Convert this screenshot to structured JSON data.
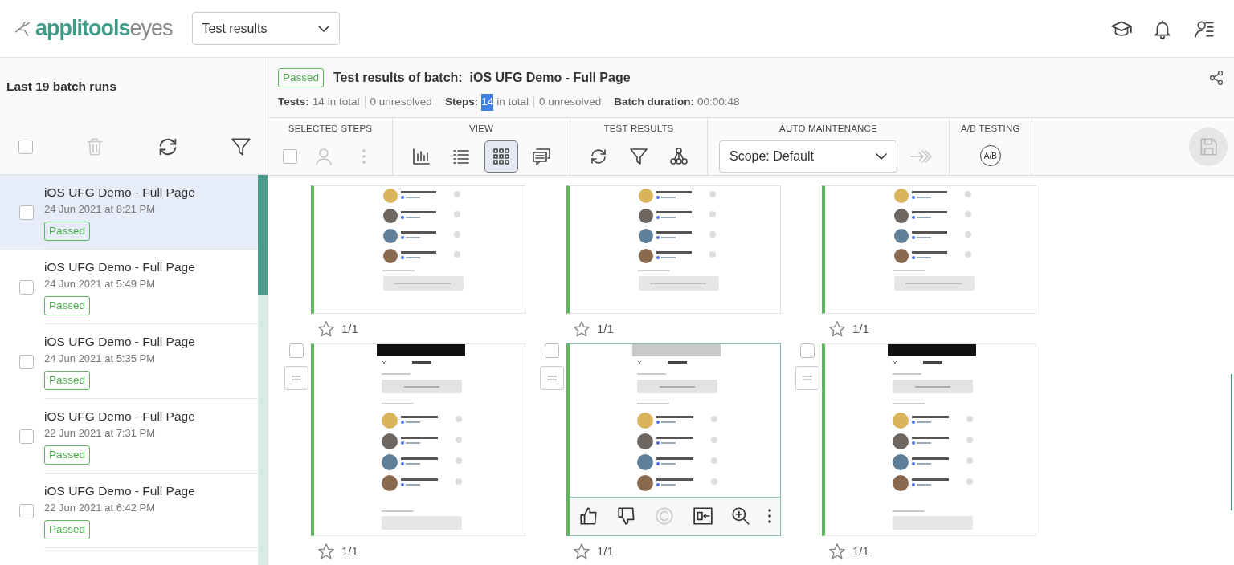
{
  "header": {
    "logo": {
      "brand": "applitools",
      "product": "eyes"
    },
    "view_select": {
      "value": "Test results"
    }
  },
  "sidebar": {
    "title": "Last 19 batch runs",
    "select_all": {
      "checked": false
    },
    "batches": [
      {
        "name": "iOS UFG Demo - Full Page",
        "date": "24 Jun 2021 at 8:21 PM",
        "status": "Passed",
        "selected": true,
        "checked": false
      },
      {
        "name": "iOS UFG Demo - Full Page",
        "date": "24 Jun 2021 at 5:49 PM",
        "status": "Passed",
        "selected": false,
        "checked": false
      },
      {
        "name": "iOS UFG Demo - Full Page",
        "date": "24 Jun 2021 at 5:35 PM",
        "status": "Passed",
        "selected": false,
        "checked": false
      },
      {
        "name": "iOS UFG Demo - Full Page",
        "date": "22 Jun 2021 at 7:31 PM",
        "status": "Passed",
        "selected": false,
        "checked": false
      },
      {
        "name": "iOS UFG Demo - Full Page",
        "date": "22 Jun 2021 at 6:42 PM",
        "status": "Passed",
        "selected": false,
        "checked": false
      }
    ]
  },
  "batch": {
    "status": "Passed",
    "title": "Test results of batch:",
    "name": "iOS UFG Demo - Full Page",
    "stats": [
      {
        "label": "Tests:",
        "count": "14",
        "count_selected": false,
        "suffix": "in total",
        "unresolved": "0 unresolved"
      },
      {
        "label": "Steps:",
        "count": "14",
        "count_selected": true,
        "suffix": "in total",
        "unresolved": "0 unresolved"
      }
    ],
    "duration": {
      "label": "Batch duration:",
      "value": "00:00:48"
    }
  },
  "toolbar": [
    {
      "title": "SELECTED STEPS",
      "tools": [
        {
          "kind": "checkbox",
          "checked": false
        },
        {
          "kind": "button",
          "disabled": true
        },
        {
          "kind": "button",
          "disabled": true
        }
      ]
    },
    {
      "title": "VIEW",
      "tools": [
        {
          "kind": "button",
          "selected": false
        },
        {
          "kind": "button",
          "selected": false
        },
        {
          "kind": "button",
          "selected": true
        },
        {
          "kind": "button",
          "selected": false
        }
      ]
    },
    {
      "title": "TEST RESULTS",
      "tools": [
        {
          "kind": "button"
        },
        {
          "kind": "button"
        },
        {
          "kind": "button"
        }
      ]
    },
    {
      "title": "AUTO MAINTENANCE",
      "tools": [
        {
          "kind": "select",
          "value": "Scope: Default"
        },
        {
          "kind": "button",
          "disabled": true
        }
      ]
    },
    {
      "title": "A/B TESTING",
      "tools": [
        {
          "kind": "text_button",
          "label": "A/B"
        }
      ]
    }
  ],
  "save": {
    "disabled": true
  },
  "steps": [
    {
      "kind": "list_bottom",
      "starred": false,
      "count": "1/1"
    },
    {
      "kind": "list_bottom",
      "starred": false,
      "count": "1/1"
    },
    {
      "kind": "list_bottom",
      "starred": false,
      "count": "1/1"
    },
    {
      "kind": "stickers_top",
      "starred": false,
      "count": "1/1",
      "checked": false,
      "hovered": false
    },
    {
      "kind": "stickers_top",
      "starred": false,
      "count": "1/1",
      "checked": false,
      "hovered": true,
      "actions": [
        {
          "disabled": false
        },
        {
          "disabled": false
        },
        {
          "disabled": true
        },
        {
          "disabled": false
        },
        {
          "disabled": false
        },
        {
          "disabled": false
        }
      ]
    },
    {
      "kind": "stickers_top",
      "starred": false,
      "count": "1/1",
      "checked": false,
      "hovered": false
    }
  ]
}
